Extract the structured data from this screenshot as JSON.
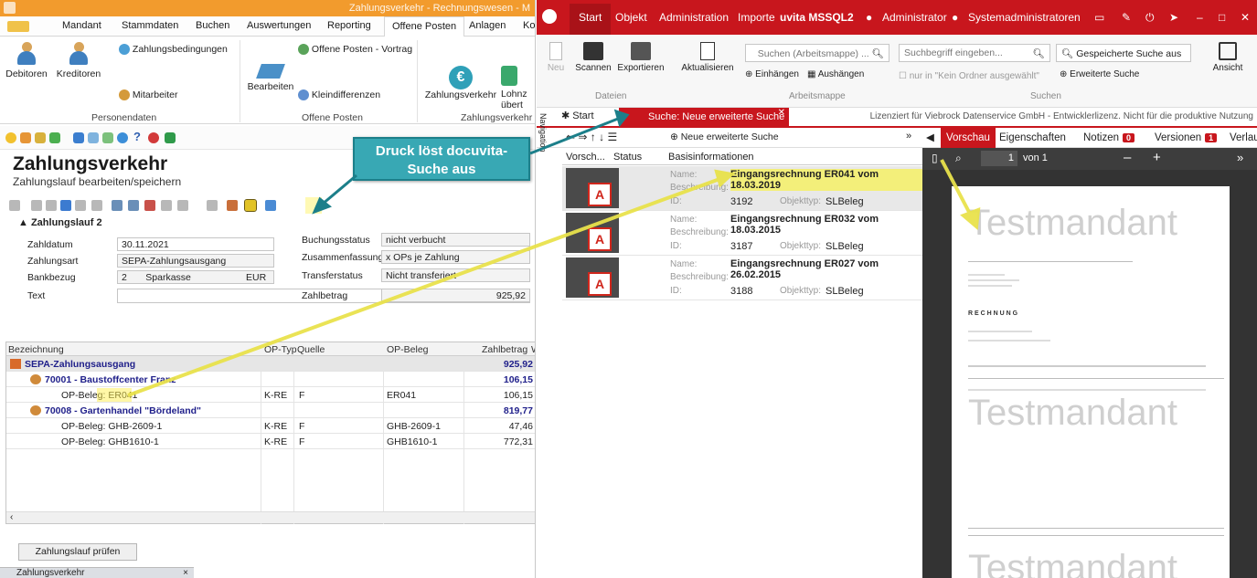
{
  "left": {
    "title": "Zahlungsverkehr - Rechnungswesen - M",
    "tabs": [
      "Mandant",
      "Stammdaten",
      "Buchen",
      "Auswertungen",
      "Reporting",
      "Offene Posten",
      "Anlagen",
      "Ko"
    ],
    "ribbon": {
      "debitoren": "Debitoren",
      "kreditoren": "Kreditoren",
      "zahlungsbedingungen": "Zahlungsbedingungen",
      "mitarbeiter": "Mitarbeiter",
      "group_personendaten": "Personendaten",
      "bearbeiten": "Bearbeiten",
      "op_vortrag": "Offene Posten - Vortrag",
      "kleindifferenzen": "Kleindifferenzen",
      "group_offene_posten": "Offene Posten",
      "zahlungsverkehr": "Zahlungsverkehr",
      "lohn_1": "Lohnz",
      "lohn_2": "übert",
      "group_zahlungsverkehr": "Zahlungsverkehr"
    },
    "page_title": "Zahlungsverkehr",
    "page_subtitle": "Zahlungslauf bearbeiten/speichern",
    "section": "Zahlungslauf 2",
    "form": {
      "zahldatum_label": "Zahldatum",
      "zahldatum": "30.11.2021",
      "zahlungsart_label": "Zahlungsart",
      "zahlungsart": "SEPA-Zahlungsausgang",
      "bankbezug_label": "Bankbezug",
      "bankbezug_nr": "2",
      "bankbezug": "Sparkasse",
      "currency": "EUR",
      "text_label": "Text",
      "buchungsstatus_label": "Buchungsstatus",
      "buchungsstatus": "nicht verbucht",
      "zusammenfassung_label": "Zusammenfassung",
      "zusammenfassung": "x OPs je Zahlung",
      "transferstatus_label": "Transferstatus",
      "transferstatus": "Nicht transferiert",
      "zahlbetrag_label": "Zahlbetrag",
      "zahlbetrag": "925,92"
    },
    "grid": {
      "headers": [
        "Bezeichnung",
        "OP-Typ",
        "Quelle",
        "OP-Beleg",
        "Zahlbetrag",
        "W"
      ],
      "rows": [
        {
          "bez": "SEPA-Zahlungsausgang",
          "typ": "",
          "quelle": "",
          "beleg": "",
          "betrag": "925,92"
        },
        {
          "bez": "70001 - Baustoffcenter Franz",
          "typ": "",
          "quelle": "",
          "beleg": "",
          "betrag": "106,15"
        },
        {
          "bez": "OP-Beleg: ER041",
          "typ": "K-RE",
          "quelle": "F",
          "beleg": "ER041",
          "betrag": "106,15"
        },
        {
          "bez": "70008 - Gartenhandel \"Bördeland\"",
          "typ": "",
          "quelle": "",
          "beleg": "",
          "betrag": "819,77"
        },
        {
          "bez": "OP-Beleg: GHB-2609-1",
          "typ": "K-RE",
          "quelle": "F",
          "beleg": "GHB-2609-1",
          "betrag": "47,46"
        },
        {
          "bez": "OP-Beleg: GHB1610-1",
          "typ": "K-RE",
          "quelle": "F",
          "beleg": "GHB1610-1",
          "betrag": "772,31"
        }
      ]
    },
    "button_pruefen": "Zahlungslauf prüfen",
    "status_tab": "Zahlungsverkehr"
  },
  "callout": {
    "line1": "Druck löst docuvita-",
    "line2": "Suche aus"
  },
  "right": {
    "menu": [
      "Start",
      "Objekt",
      "Administration",
      "Importe",
      "uvita MSSQL2",
      "Administrator",
      "Systemadministratoren"
    ],
    "ribbon": {
      "neu": "Neu",
      "scannen": "Scannen",
      "exportieren": "Exportieren",
      "group_dateien": "Dateien",
      "aktualisieren": "Aktualisieren",
      "search_ws_placeholder": "Suchen (Arbeitsmappe) ...",
      "einhaengen": "Einhängen",
      "aushaengen": "Aushängen",
      "group_arbeitsmappe": "Arbeitsmappe",
      "suchbegriff_placeholder": "Suchbegriff eingeben...",
      "nur_in": "nur in \"Kein Ordner ausgewählt\"",
      "gespeicherte": "Gespeicherte Suche aus",
      "erweiterte": "Erweiterte Suche",
      "group_suchen": "Suchen",
      "ansicht": "Ansicht"
    },
    "tab_start": "Start",
    "tab_search": "Suche: Neue erweiterte Suche",
    "license": "Lizenziert für Viebrock Datenservice GmbH - Entwicklerlizenz. Nicht für die produktive Nutzung",
    "nav_new_search": "Neue erweiterte Suche",
    "side_label": "Navigation",
    "grid_headers": [
      "Vorsch...",
      "Status",
      "Basisinformationen"
    ],
    "label_name": "Name:",
    "label_desc": "Beschreibung:",
    "label_id": "ID:",
    "label_type": "Objekttyp:",
    "docs": [
      {
        "name": "Eingangsrechnung ER041 vom 18.03.2019",
        "id": "3192",
        "type": "SLBeleg"
      },
      {
        "name": "Eingangsrechnung ER032 vom 18.03.2015",
        "id": "3187",
        "type": "SLBeleg"
      },
      {
        "name": "Eingangsrechnung ER027 vom 26.02.2015",
        "id": "3188",
        "type": "SLBeleg"
      }
    ],
    "preview_tabs": {
      "vorschau": "Vorschau",
      "eigenschaften": "Eigenschaften",
      "notizen": "Notizen",
      "notizen_count": "0",
      "versionen": "Versionen",
      "versionen_count": "1",
      "verlauf": "Verlau"
    },
    "viewer": {
      "page": "1",
      "of": "von 1",
      "watermark": "Testmandant",
      "rechnung": "R E C H N U N G"
    }
  }
}
